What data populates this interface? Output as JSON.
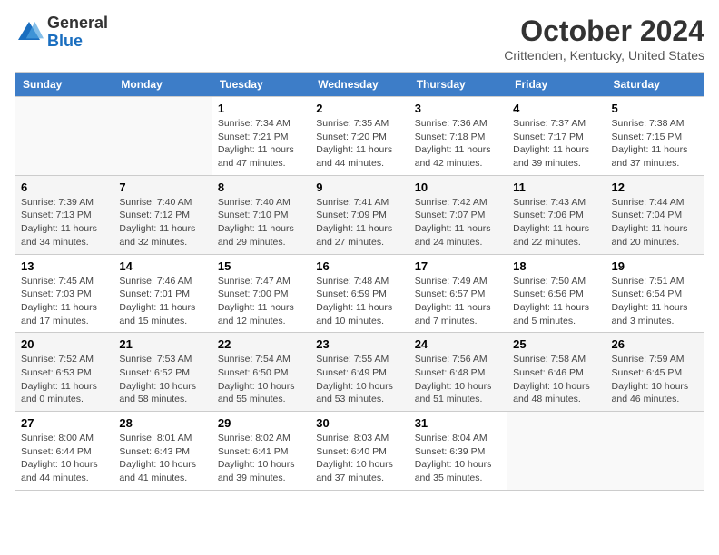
{
  "header": {
    "logo_general": "General",
    "logo_blue": "Blue",
    "month_title": "October 2024",
    "location": "Crittenden, Kentucky, United States"
  },
  "days_of_week": [
    "Sunday",
    "Monday",
    "Tuesday",
    "Wednesday",
    "Thursday",
    "Friday",
    "Saturday"
  ],
  "weeks": [
    [
      {
        "day": "",
        "info": ""
      },
      {
        "day": "",
        "info": ""
      },
      {
        "day": "1",
        "info": "Sunrise: 7:34 AM\nSunset: 7:21 PM\nDaylight: 11 hours and 47 minutes."
      },
      {
        "day": "2",
        "info": "Sunrise: 7:35 AM\nSunset: 7:20 PM\nDaylight: 11 hours and 44 minutes."
      },
      {
        "day": "3",
        "info": "Sunrise: 7:36 AM\nSunset: 7:18 PM\nDaylight: 11 hours and 42 minutes."
      },
      {
        "day": "4",
        "info": "Sunrise: 7:37 AM\nSunset: 7:17 PM\nDaylight: 11 hours and 39 minutes."
      },
      {
        "day": "5",
        "info": "Sunrise: 7:38 AM\nSunset: 7:15 PM\nDaylight: 11 hours and 37 minutes."
      }
    ],
    [
      {
        "day": "6",
        "info": "Sunrise: 7:39 AM\nSunset: 7:13 PM\nDaylight: 11 hours and 34 minutes."
      },
      {
        "day": "7",
        "info": "Sunrise: 7:40 AM\nSunset: 7:12 PM\nDaylight: 11 hours and 32 minutes."
      },
      {
        "day": "8",
        "info": "Sunrise: 7:40 AM\nSunset: 7:10 PM\nDaylight: 11 hours and 29 minutes."
      },
      {
        "day": "9",
        "info": "Sunrise: 7:41 AM\nSunset: 7:09 PM\nDaylight: 11 hours and 27 minutes."
      },
      {
        "day": "10",
        "info": "Sunrise: 7:42 AM\nSunset: 7:07 PM\nDaylight: 11 hours and 24 minutes."
      },
      {
        "day": "11",
        "info": "Sunrise: 7:43 AM\nSunset: 7:06 PM\nDaylight: 11 hours and 22 minutes."
      },
      {
        "day": "12",
        "info": "Sunrise: 7:44 AM\nSunset: 7:04 PM\nDaylight: 11 hours and 20 minutes."
      }
    ],
    [
      {
        "day": "13",
        "info": "Sunrise: 7:45 AM\nSunset: 7:03 PM\nDaylight: 11 hours and 17 minutes."
      },
      {
        "day": "14",
        "info": "Sunrise: 7:46 AM\nSunset: 7:01 PM\nDaylight: 11 hours and 15 minutes."
      },
      {
        "day": "15",
        "info": "Sunrise: 7:47 AM\nSunset: 7:00 PM\nDaylight: 11 hours and 12 minutes."
      },
      {
        "day": "16",
        "info": "Sunrise: 7:48 AM\nSunset: 6:59 PM\nDaylight: 11 hours and 10 minutes."
      },
      {
        "day": "17",
        "info": "Sunrise: 7:49 AM\nSunset: 6:57 PM\nDaylight: 11 hours and 7 minutes."
      },
      {
        "day": "18",
        "info": "Sunrise: 7:50 AM\nSunset: 6:56 PM\nDaylight: 11 hours and 5 minutes."
      },
      {
        "day": "19",
        "info": "Sunrise: 7:51 AM\nSunset: 6:54 PM\nDaylight: 11 hours and 3 minutes."
      }
    ],
    [
      {
        "day": "20",
        "info": "Sunrise: 7:52 AM\nSunset: 6:53 PM\nDaylight: 11 hours and 0 minutes."
      },
      {
        "day": "21",
        "info": "Sunrise: 7:53 AM\nSunset: 6:52 PM\nDaylight: 10 hours and 58 minutes."
      },
      {
        "day": "22",
        "info": "Sunrise: 7:54 AM\nSunset: 6:50 PM\nDaylight: 10 hours and 55 minutes."
      },
      {
        "day": "23",
        "info": "Sunrise: 7:55 AM\nSunset: 6:49 PM\nDaylight: 10 hours and 53 minutes."
      },
      {
        "day": "24",
        "info": "Sunrise: 7:56 AM\nSunset: 6:48 PM\nDaylight: 10 hours and 51 minutes."
      },
      {
        "day": "25",
        "info": "Sunrise: 7:58 AM\nSunset: 6:46 PM\nDaylight: 10 hours and 48 minutes."
      },
      {
        "day": "26",
        "info": "Sunrise: 7:59 AM\nSunset: 6:45 PM\nDaylight: 10 hours and 46 minutes."
      }
    ],
    [
      {
        "day": "27",
        "info": "Sunrise: 8:00 AM\nSunset: 6:44 PM\nDaylight: 10 hours and 44 minutes."
      },
      {
        "day": "28",
        "info": "Sunrise: 8:01 AM\nSunset: 6:43 PM\nDaylight: 10 hours and 41 minutes."
      },
      {
        "day": "29",
        "info": "Sunrise: 8:02 AM\nSunset: 6:41 PM\nDaylight: 10 hours and 39 minutes."
      },
      {
        "day": "30",
        "info": "Sunrise: 8:03 AM\nSunset: 6:40 PM\nDaylight: 10 hours and 37 minutes."
      },
      {
        "day": "31",
        "info": "Sunrise: 8:04 AM\nSunset: 6:39 PM\nDaylight: 10 hours and 35 minutes."
      },
      {
        "day": "",
        "info": ""
      },
      {
        "day": "",
        "info": ""
      }
    ]
  ]
}
